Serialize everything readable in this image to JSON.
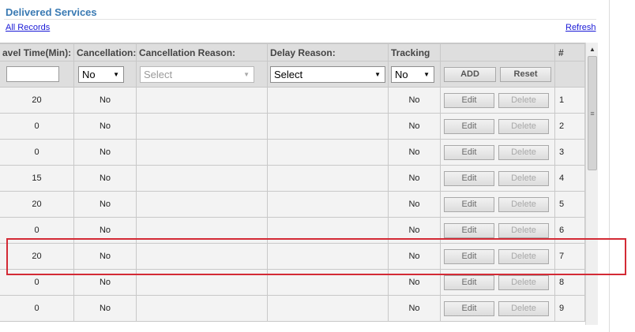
{
  "panel": {
    "title": "Delivered Services",
    "all_records_link": "All Records",
    "refresh_link": "Refresh"
  },
  "columns": [
    {
      "key": "travel_time",
      "label": "avel Time(Min):"
    },
    {
      "key": "cancellation",
      "label": "Cancellation:"
    },
    {
      "key": "cancellation_reason",
      "label": "Cancellation Reason:"
    },
    {
      "key": "delay_reason",
      "label": "Delay Reason:"
    },
    {
      "key": "tracking",
      "label": "Tracking"
    },
    {
      "key": "actions",
      "label": ""
    },
    {
      "key": "index",
      "label": "#"
    }
  ],
  "filter": {
    "travel_time_value": "",
    "cancellation_value": "No",
    "cancellation_reason_placeholder": "Select",
    "delay_reason_value": "Select",
    "tracking_value": "No",
    "add_label": "ADD",
    "reset_label": "Reset"
  },
  "row_buttons": {
    "edit": "Edit",
    "delete": "Delete"
  },
  "rows": [
    {
      "travel_time": "20",
      "cancellation": "No",
      "cancellation_reason": "",
      "delay_reason": "",
      "tracking": "No",
      "index": "1"
    },
    {
      "travel_time": "0",
      "cancellation": "No",
      "cancellation_reason": "",
      "delay_reason": "",
      "tracking": "No",
      "index": "2"
    },
    {
      "travel_time": "0",
      "cancellation": "No",
      "cancellation_reason": "",
      "delay_reason": "",
      "tracking": "No",
      "index": "3"
    },
    {
      "travel_time": "15",
      "cancellation": "No",
      "cancellation_reason": "",
      "delay_reason": "",
      "tracking": "No",
      "index": "4"
    },
    {
      "travel_time": "20",
      "cancellation": "No",
      "cancellation_reason": "",
      "delay_reason": "",
      "tracking": "No",
      "index": "5"
    },
    {
      "travel_time": "0",
      "cancellation": "No",
      "cancellation_reason": "",
      "delay_reason": "",
      "tracking": "No",
      "index": "6"
    },
    {
      "travel_time": "20",
      "cancellation": "No",
      "cancellation_reason": "",
      "delay_reason": "",
      "tracking": "No",
      "index": "7"
    },
    {
      "travel_time": "0",
      "cancellation": "No",
      "cancellation_reason": "",
      "delay_reason": "",
      "tracking": "No",
      "index": "8"
    },
    {
      "travel_time": "0",
      "cancellation": "No",
      "cancellation_reason": "",
      "delay_reason": "",
      "tracking": "No",
      "index": "9"
    }
  ],
  "highlighted_row_index": "7",
  "icons": {
    "dropdown": "chevron-down-icon",
    "scroll_up": "scroll-up-arrow-icon",
    "scroll_grip": "scroll-grip-icon"
  },
  "colors": {
    "title": "#3a7ab3",
    "link": "#1a1ad6",
    "highlight": "#d32a35",
    "header_bg": "#dedede",
    "row_bg": "#f3f3f3"
  }
}
